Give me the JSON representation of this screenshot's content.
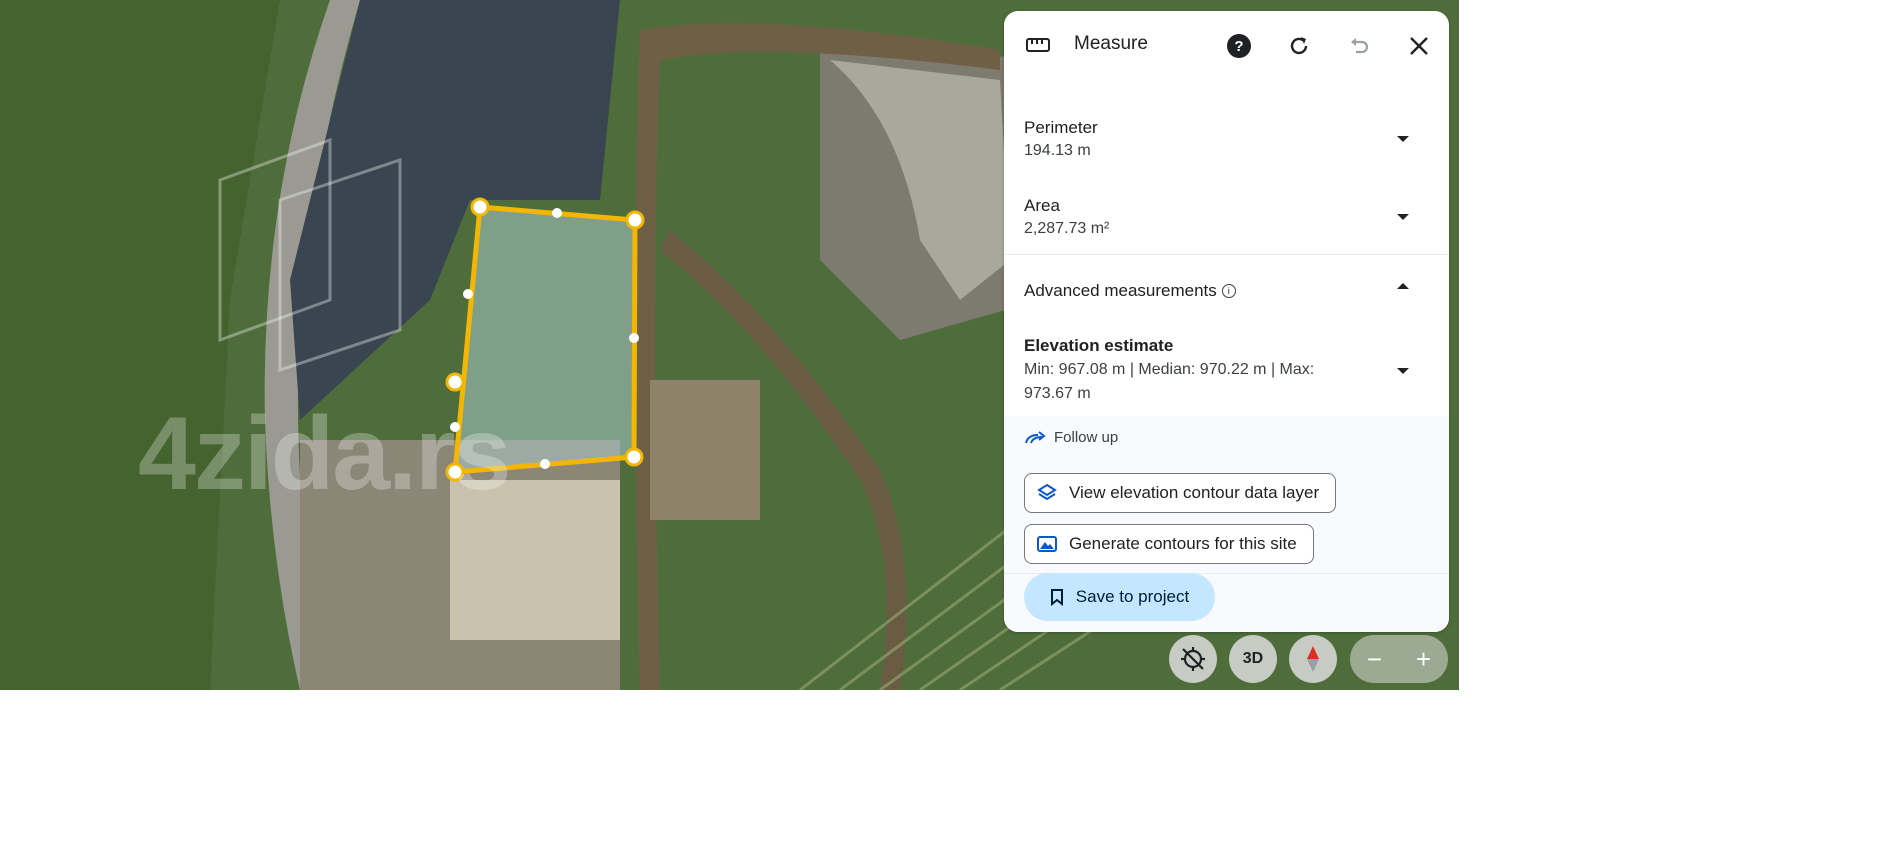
{
  "map": {
    "watermark": "4zida.rs"
  },
  "panel": {
    "title": "Measure",
    "icons": {
      "ruler": "ruler-icon",
      "help": "help-icon",
      "refresh": "refresh-icon",
      "undo": "undo-icon",
      "close": "close-icon"
    },
    "perimeter": {
      "label": "Perimeter",
      "value": "194.13 m"
    },
    "area": {
      "label": "Area",
      "value": "2,287.73 m²"
    },
    "advanced": {
      "label": "Advanced measurements"
    },
    "elevation": {
      "label": "Elevation estimate",
      "value": "Min: 967.08 m | Median: 970.22 m | Max: 973.67 m"
    },
    "followup": {
      "title": "Follow up",
      "chips": [
        {
          "label": "View elevation contour data layer",
          "icon": "layers-icon"
        },
        {
          "label": "Generate contours for this site",
          "icon": "terrain-icon"
        }
      ]
    },
    "save_label": "Save to project"
  },
  "controls": {
    "three_d_label": "3D",
    "zoom_out": "−",
    "zoom_in": "+"
  },
  "colors": {
    "polygon_stroke": "#f2b705",
    "accent": "#c2e7ff",
    "link_blue": "#0b57d0"
  }
}
